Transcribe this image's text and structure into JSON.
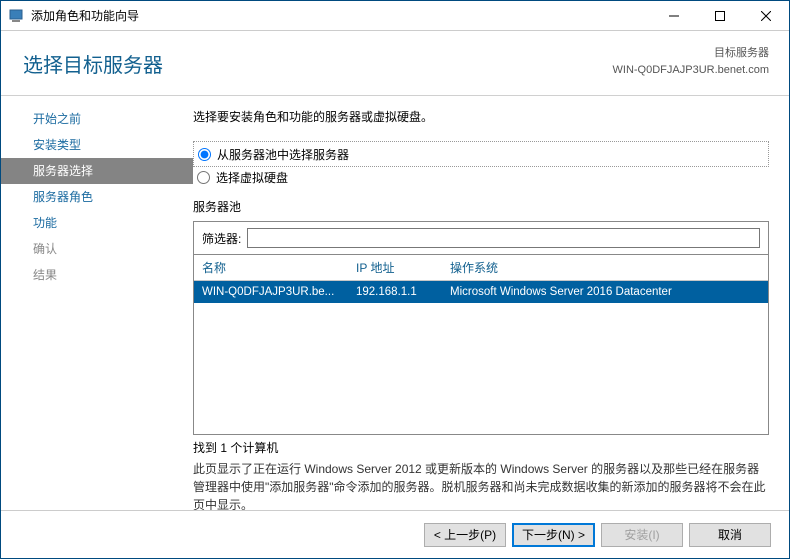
{
  "window": {
    "title": "添加角色和功能向导"
  },
  "header": {
    "title": "选择目标服务器",
    "target_label": "目标服务器",
    "target_value": "WIN-Q0DFJAJP3UR.benet.com"
  },
  "sidebar": {
    "items": [
      {
        "label": "开始之前",
        "state": "enabled"
      },
      {
        "label": "安装类型",
        "state": "enabled"
      },
      {
        "label": "服务器选择",
        "state": "active"
      },
      {
        "label": "服务器角色",
        "state": "enabled"
      },
      {
        "label": "功能",
        "state": "enabled"
      },
      {
        "label": "确认",
        "state": "disabled"
      },
      {
        "label": "结果",
        "state": "disabled"
      }
    ]
  },
  "main": {
    "intro": "选择要安装角色和功能的服务器或虚拟硬盘。",
    "radio1": "从服务器池中选择服务器",
    "radio2": "选择虚拟硬盘",
    "pool_label": "服务器池",
    "filter_label": "筛选器:",
    "filter_value": "",
    "columns": {
      "name": "名称",
      "ip": "IP 地址",
      "os": "操作系统"
    },
    "rows": [
      {
        "name": "WIN-Q0DFJAJP3UR.be...",
        "ip": "192.168.1.1",
        "os": "Microsoft Windows Server 2016 Datacenter"
      }
    ],
    "found": "找到 1 个计算机",
    "hint": "此页显示了正在运行 Windows Server 2012 或更新版本的 Windows Server 的服务器以及那些已经在服务器管理器中使用\"添加服务器\"命令添加的服务器。脱机服务器和尚未完成数据收集的新添加的服务器将不会在此页中显示。"
  },
  "footer": {
    "prev": "< 上一步(P)",
    "next": "下一步(N) >",
    "install": "安装(I)",
    "cancel": "取消"
  }
}
